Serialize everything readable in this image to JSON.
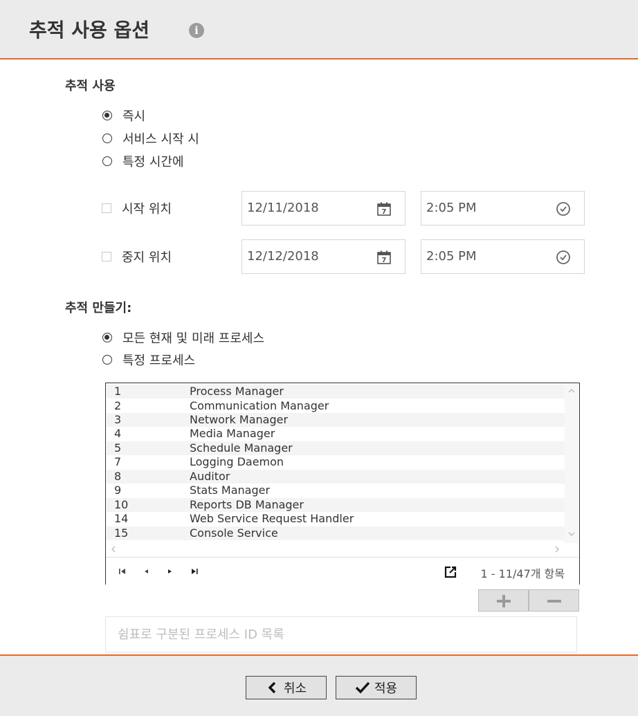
{
  "header": {
    "title": "추적 사용 옵션",
    "info_icon": "info-icon"
  },
  "enable": {
    "label": "추적 사용",
    "options": [
      {
        "label": "즉시",
        "checked": true
      },
      {
        "label": "서비스 시작 시",
        "checked": false
      },
      {
        "label": "특정 시간에",
        "checked": false
      }
    ],
    "start": {
      "label": "시작 위치",
      "date": "12/11/2018",
      "time": "2:05 PM"
    },
    "stop": {
      "label": "중지 위치",
      "date": "12/12/2018",
      "time": "2:05 PM"
    }
  },
  "create": {
    "label": "추적 만들기:",
    "options": [
      {
        "label": "모든 현재 및 미래 프로세스",
        "checked": true
      },
      {
        "label": "특정 프로세스",
        "checked": false
      }
    ]
  },
  "table": {
    "rows": [
      {
        "id": "1",
        "name": "Process Manager"
      },
      {
        "id": "2",
        "name": "Communication Manager"
      },
      {
        "id": "3",
        "name": "Network Manager"
      },
      {
        "id": "4",
        "name": "Media Manager"
      },
      {
        "id": "5",
        "name": "Schedule Manager"
      },
      {
        "id": "7",
        "name": "Logging Daemon"
      },
      {
        "id": "8",
        "name": "Auditor"
      },
      {
        "id": "9",
        "name": "Stats Manager"
      },
      {
        "id": "10",
        "name": "Reports DB Manager"
      },
      {
        "id": "14",
        "name": "Web Service Request Handler"
      },
      {
        "id": "15",
        "name": "Console Service"
      }
    ],
    "pager_text": "1 - 11/47개 항목"
  },
  "process_input": {
    "placeholder": "쉼표로 구분된 프로세스 ID 목록",
    "value": ""
  },
  "footer": {
    "cancel_label": "취소",
    "apply_label": "적용"
  },
  "colors": {
    "accent": "#e06a2e",
    "header_bg": "#ebebeb"
  }
}
